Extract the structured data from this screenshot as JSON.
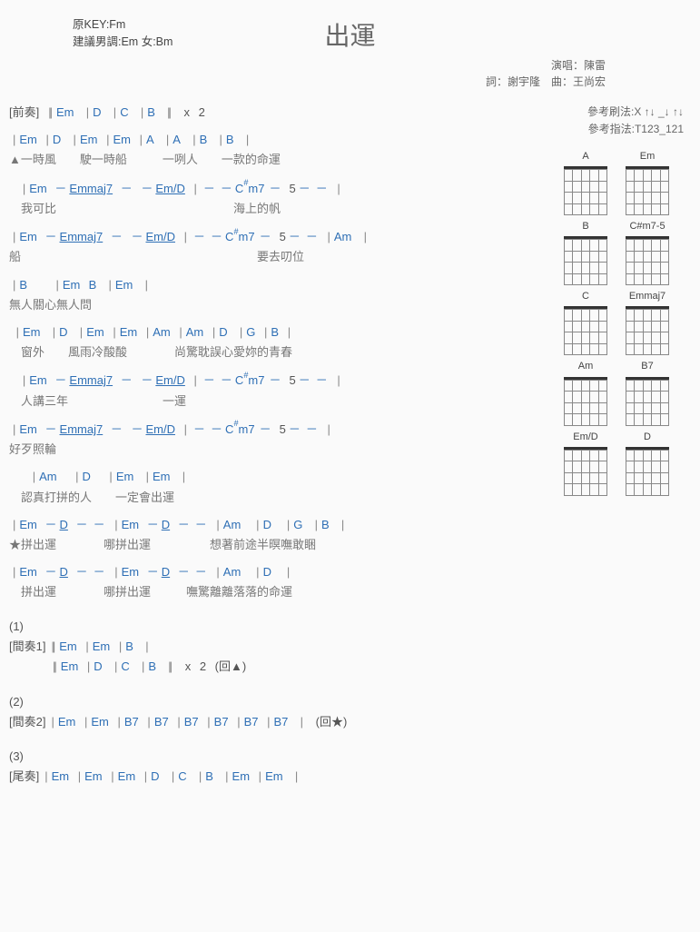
{
  "song": {
    "title": "出運",
    "key_original": "原KEY:Fm",
    "key_suggest": "建議男調:Em 女:Bm",
    "perform": "演唱：陳雷",
    "credits": "詞：謝宇隆　曲：王尚宏"
  },
  "ref": {
    "strum": "參考刷法:X ↑↓ _↓ ↑↓",
    "finger": "參考指法:T123_121"
  },
  "diagrams": [
    "A",
    "Em",
    "B",
    "C#m7-5",
    "C",
    "Emmaj7",
    "Am",
    "B7",
    "Em/D",
    "D"
  ],
  "intro": {
    "marker": "[前奏]",
    "bars": "||Em　 |D　 |C　 |B　 || x 2"
  },
  "verse": [
    {
      "chords": "|Em　|D　 |Em　|Em　|A　 |A　 |B　 |B　 |",
      "lyric": "▲一時風　　駛一時船　　　一咧人　　一款的命運"
    },
    {
      "chords": "　　　|Em　－Emmaj7 － －Em/D　|－－C#m7-5－－　|",
      "lyric": "　我可比　　　　　　　　　　　　　　　海上的帆"
    },
    {
      "chords": "|Em　－Emmaj7 － －Em/D　|－－C#m7-5－－　|Am　　|",
      "lyric": "船　　　　　　　　　　　　　　　　　　　　要去叨位"
    },
    {
      "chords": "|B　　　　　　　|Em　 B　 |Em　　|",
      "lyric": "無人關心無人問"
    },
    {
      "chords": "　|Em　 |D　　|Em　|Em　|Am　|Am　|D　 |G　|B　|",
      "lyric": "　窗外　　風雨冷酸酸　　　　尚驚耽誤心愛妳的青春"
    },
    {
      "chords": "　　　|Em　－Emmaj7 － －Em/D　|－－C#m7-5－－　|",
      "lyric": "　人講三年　　　　　　　　一運"
    },
    {
      "chords": "|Em　－Emmaj7 － －Em/D　|－－C#m7-5－－　|",
      "lyric": "好歹照輪"
    },
    {
      "chords": "　　　　　　|Am　　　　|D　　　　|Em　 |Em　 |",
      "lyric": "　認真打拼的人　　一定會出運"
    }
  ],
  "chorus": [
    {
      "chords": "|Em　－D －－　|Em　－D －－　|Am　　　|D　　　|G　 |B　 |",
      "lyric": "★拼出運　　　　哪拼出運　　　　　想著前途半暝嘸敢睏"
    },
    {
      "chords": "|Em　－D －－　|Em　－D －－　|Am　　　|D　　　|",
      "lyric": "　拼出運　　　　哪拼出運　　　嘸驚離離落落的命運"
    }
  ],
  "sections": [
    {
      "num": "(1)",
      "marker": "[間奏1]",
      "bars1": "||Em　|Em　|B　 |",
      "bars2": "||Em　|D　 |C　 |B　 || x 2　(回▲)"
    },
    {
      "num": "(2)",
      "marker": "[間奏2]",
      "bars1": "|Em　|Em　|B7　|B7　|B7　|B7　|B7　|B7　 |　(回★)"
    },
    {
      "num": "(3)",
      "marker": "[尾奏]",
      "bars1": "|Em　|Em　|Em　|D　 |C　 |B　 |Em　|Em　 |"
    }
  ]
}
